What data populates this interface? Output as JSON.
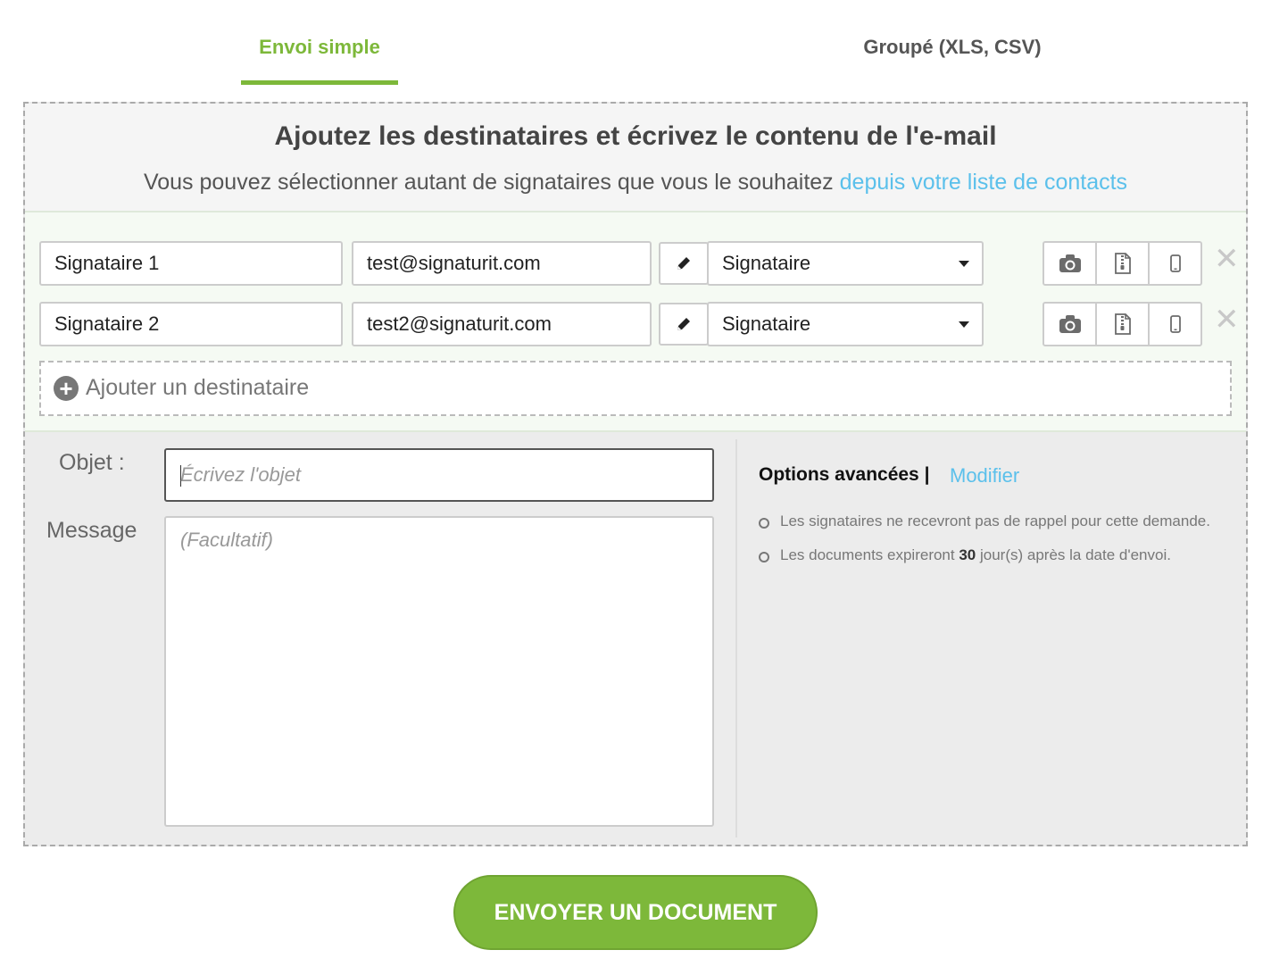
{
  "tabs": {
    "simple": "Envoi simple",
    "group": "Groupé (XLS, CSV)"
  },
  "header": {
    "title": "Ajoutez les destinataires et écrivez le contenu de l'e-mail",
    "subtitle_text": "Vous pouvez sélectionner autant de signataires que vous le souhaitez",
    "subtitle_link": "depuis votre liste de contacts"
  },
  "recipients": [
    {
      "name": "Signataire 1",
      "email": "test@signaturit.com",
      "role": "Signataire"
    },
    {
      "name": "Signataire 2",
      "email": "test2@signaturit.com",
      "role": "Signataire"
    }
  ],
  "add_recipient": "Ajouter un destinataire",
  "form": {
    "subject_label": "Objet :",
    "subject_placeholder": "Écrivez l'objet",
    "message_label": "Message",
    "message_placeholder": "(Facultatif)"
  },
  "options": {
    "title": "Options avancées |",
    "modify": "Modifier",
    "items": [
      {
        "text": "Les signataires ne recevront pas de rappel pour cette demande."
      },
      {
        "before": "Les documents expireront",
        "bold": "30",
        "after": "jour(s) après la date d'envoi."
      }
    ]
  },
  "send_button": "ENVOYER UN DOCUMENT",
  "colors": {
    "accent": "#7db83a",
    "link": "#5bc0eb"
  },
  "icons": [
    "pencil-icon",
    "caret-down-icon",
    "camera-icon",
    "zip-file-icon",
    "mobile-phone-icon",
    "close-icon",
    "plus-circle-icon"
  ]
}
